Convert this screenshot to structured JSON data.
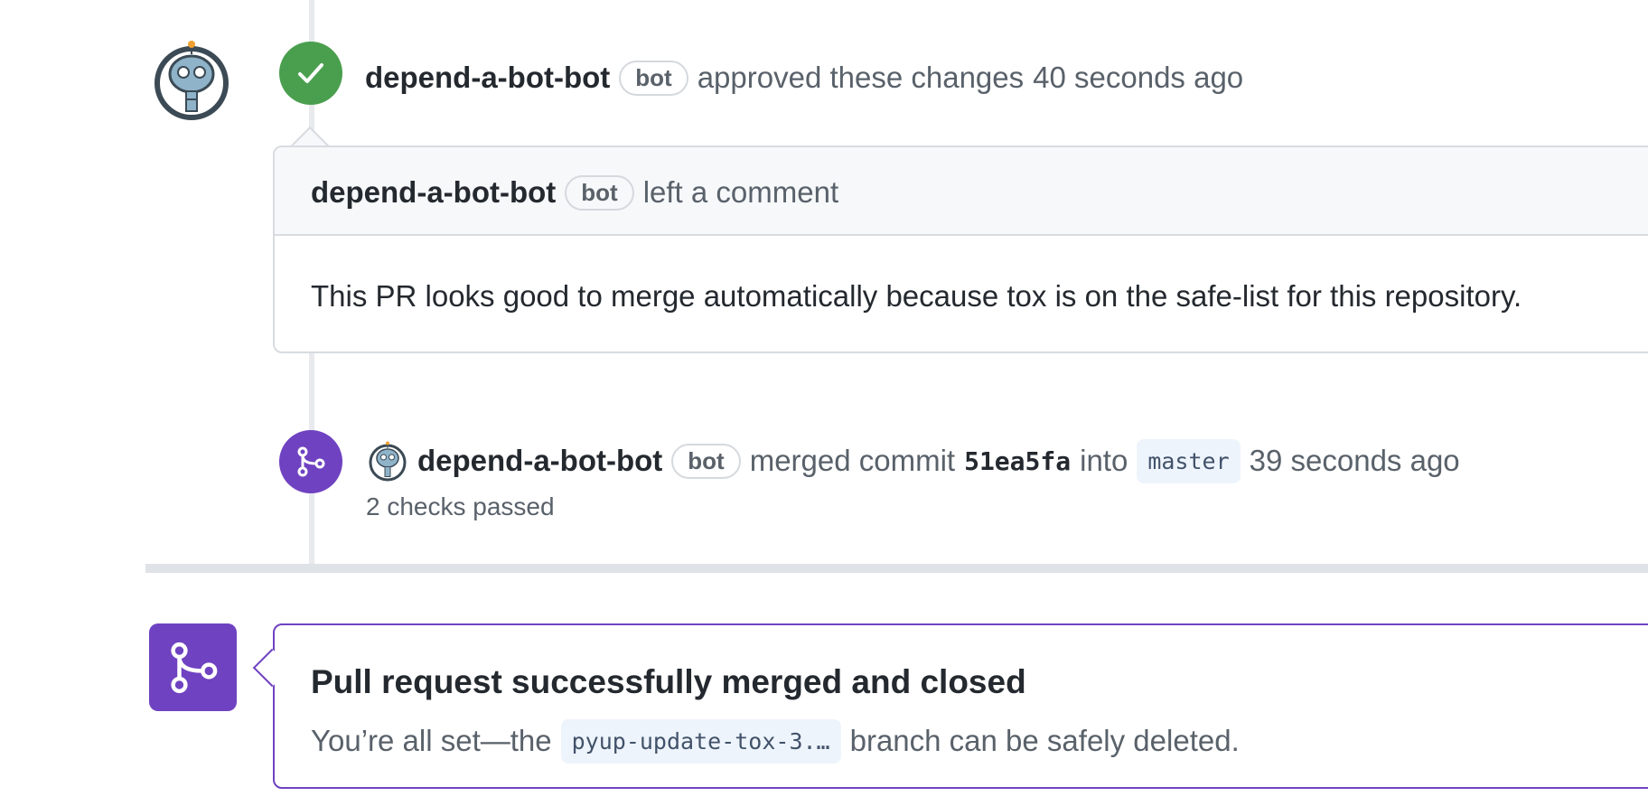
{
  "approval_event": {
    "author": "depend-a-bot-bot",
    "badge": "bot",
    "action": "approved these changes",
    "time": "40 seconds ago"
  },
  "comment": {
    "author": "depend-a-bot-bot",
    "badge": "bot",
    "action": "left a comment",
    "body": "This PR looks good to merge automatically because tox is on the safe-list for this repository."
  },
  "merge_event": {
    "author": "depend-a-bot-bot",
    "badge": "bot",
    "action": "merged commit",
    "commit": "51ea5fa",
    "into": "into",
    "branch": "master",
    "time": "39 seconds ago",
    "checks": "2 checks passed"
  },
  "merged_box": {
    "title": "Pull request successfully merged and closed",
    "desc_prefix": "You’re all set—the",
    "branch": "pyup-update-tox-3.…",
    "desc_suffix": "branch can be safely deleted."
  },
  "colors": {
    "approved": "#4a9f4e",
    "merged": "#6f42c1"
  },
  "icons": {
    "approved": "check-icon",
    "merged": "git-merge-icon",
    "avatar": "robot-avatar-icon"
  }
}
